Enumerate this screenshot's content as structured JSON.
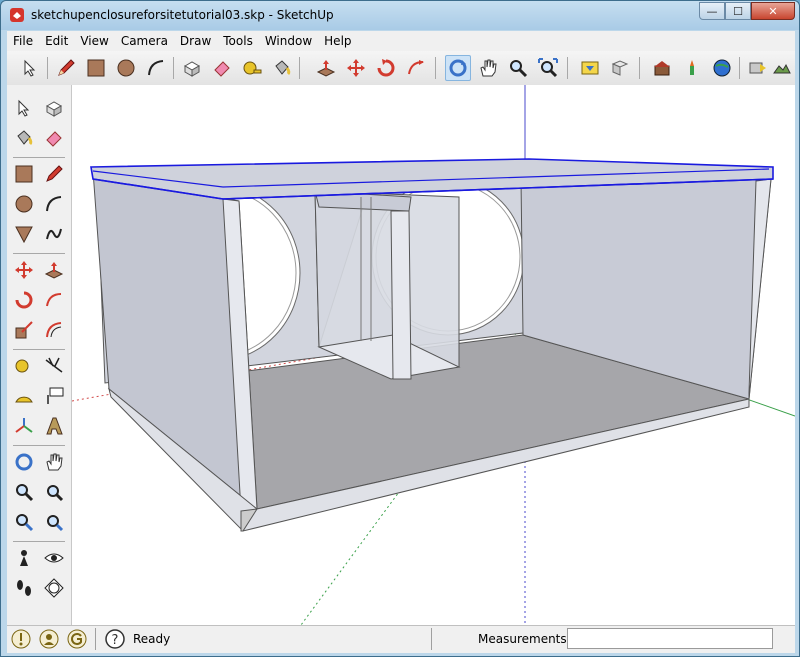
{
  "window": {
    "title": "sketchupenclosureforsitetutorial03.skp - SketchUp",
    "minimize_glyph": "—",
    "maximize_glyph": "☐",
    "close_glyph": "✕"
  },
  "menu": [
    {
      "key": "file",
      "label": "File"
    },
    {
      "key": "edit",
      "label": "Edit"
    },
    {
      "key": "view",
      "label": "View"
    },
    {
      "key": "camera",
      "label": "Camera"
    },
    {
      "key": "draw",
      "label": "Draw"
    },
    {
      "key": "tools",
      "label": "Tools"
    },
    {
      "key": "window",
      "label": "Window"
    },
    {
      "key": "help",
      "label": "Help"
    }
  ],
  "toolbar_icons": [
    "select-icon",
    "pencil-icon",
    "rectangle-icon",
    "circle-icon",
    "arc-icon",
    "make-component-icon",
    "eraser-icon",
    "tape-measure-icon",
    "paint-bucket-icon",
    "push-pull-icon",
    "move-icon",
    "rotate-icon",
    "follow-me-icon",
    "orbit-icon",
    "pan-icon",
    "zoom-icon",
    "zoom-extents-icon",
    "get-models-icon",
    "share-model-icon",
    "3d-warehouse-icon",
    "component-icon",
    "google-earth-icon",
    "get-current-view-icon",
    "toggle-terrain-icon"
  ],
  "status": {
    "ready_text": "Ready",
    "measurements_label": "Measurements",
    "measurements_value": "",
    "help_glyph": "?"
  },
  "colors": {
    "selection_blue": "#1a1adf",
    "box_fill": "#c8cbd6",
    "floor_fill": "#a6a6aa",
    "axis_red": "#d24b4b",
    "axis_green": "#3aa04a",
    "axis_blue": "#4a4acd"
  }
}
